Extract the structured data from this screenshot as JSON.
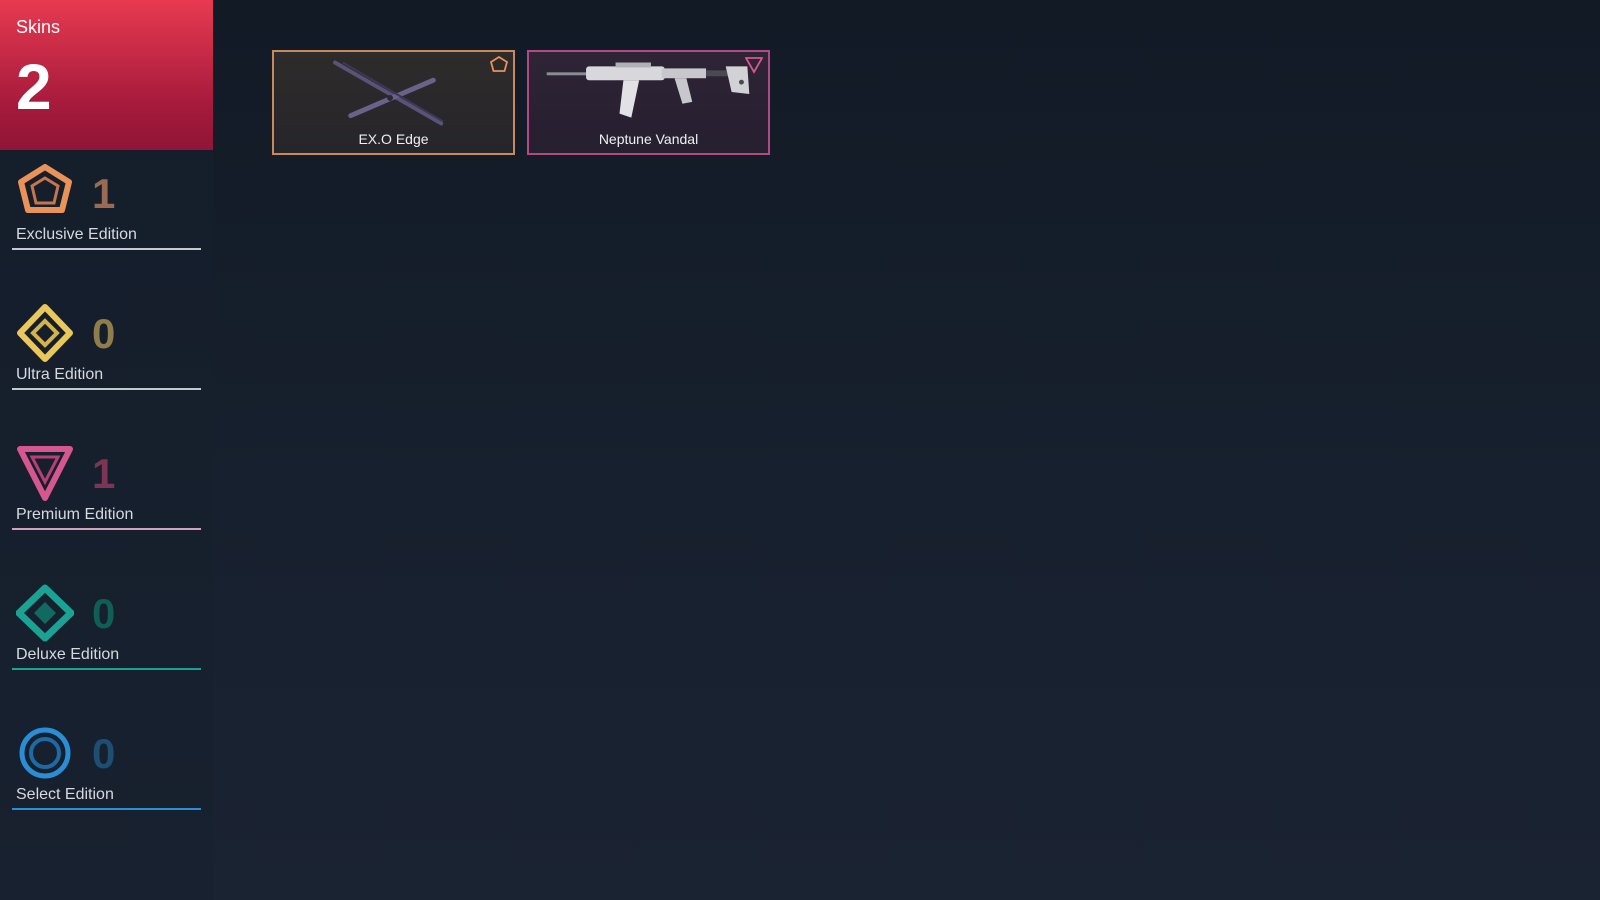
{
  "skins": {
    "title": "Skins",
    "count": "2"
  },
  "editions": [
    {
      "label": "Exclusive Edition",
      "count": "1",
      "icon": "exclusive-edition-icon",
      "color": "#e9925a",
      "count_color": "#9b6a52"
    },
    {
      "label": "Ultra Edition",
      "count": "0",
      "icon": "ultra-edition-icon",
      "color": "#e9c75a",
      "count_color": "#8f7d4c"
    },
    {
      "label": "Premium Edition",
      "count": "1",
      "icon": "premium-edition-icon",
      "color": "#d6568f",
      "count_color": "#7c3653"
    },
    {
      "label": "Deluxe Edition",
      "count": "0",
      "icon": "deluxe-edition-icon",
      "color": "#1aa392",
      "count_color": "#0f5f57"
    },
    {
      "label": "Select Edition",
      "count": "0",
      "icon": "select-edition-icon",
      "color": "#2a8ed6",
      "count_color": "#1e4e72"
    }
  ],
  "cards": [
    {
      "name": "EX.O Edge",
      "tier": "exclusive-edition-icon",
      "border": "#c88a5a",
      "bg": "#2a2a2c"
    },
    {
      "name": "Neptune Vandal",
      "tier": "premium-edition-icon",
      "border": "#b04a82",
      "bg": "#2a2234"
    }
  ]
}
